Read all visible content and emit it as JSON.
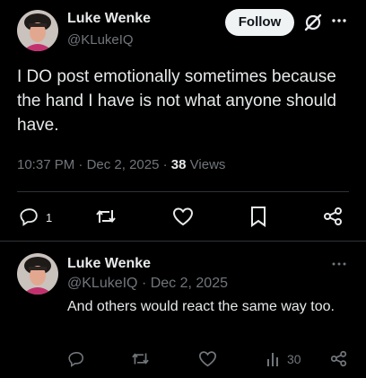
{
  "main_tweet": {
    "author_name": "Luke Wenke",
    "author_handle": "@KLukeIQ",
    "follow_label": "Follow",
    "text": "I DO post emotionally sometimes because the hand I have is not what anyone should have.",
    "time": "10:37 PM",
    "date": "Dec 2, 2025",
    "views_count": "38",
    "views_label": "Views",
    "reply_count": "1"
  },
  "reply_tweet": {
    "author_name": "Luke Wenke",
    "author_handle": "@KLukeIQ",
    "date": "Dec 2, 2025",
    "text": "And others would react the same way too.",
    "views_count": "30"
  },
  "icons": {
    "more": "more-icon",
    "grok": "grok-icon",
    "reply": "reply-icon",
    "repost": "repost-icon",
    "like": "like-icon",
    "bookmark": "bookmark-icon",
    "share": "share-icon",
    "views": "views-icon"
  },
  "colors": {
    "background": "#000000",
    "text_primary": "#e7e9ea",
    "text_secondary": "#71767b",
    "divider": "#2f3336",
    "follow_bg": "#eff3f4"
  }
}
